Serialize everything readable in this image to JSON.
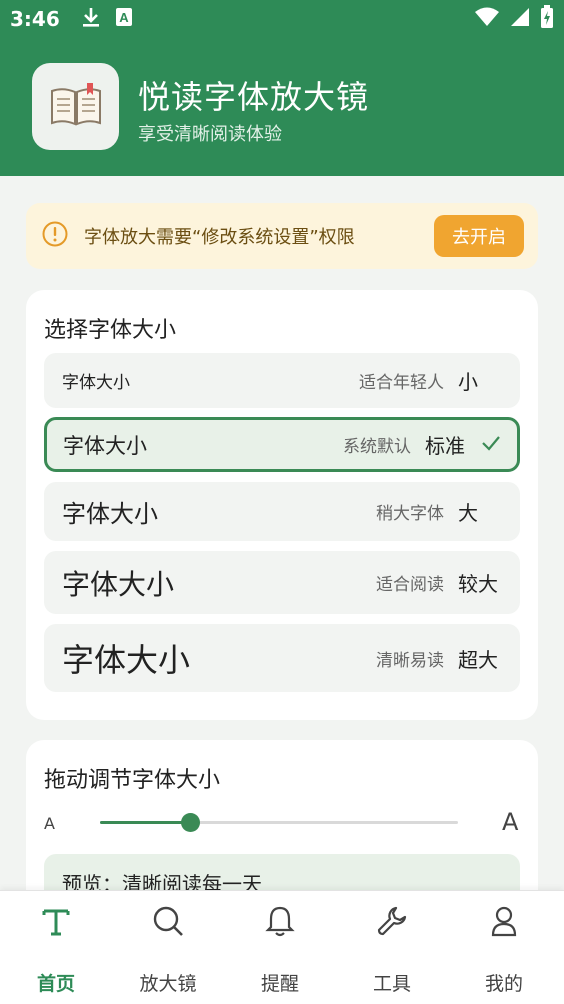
{
  "status_bar": {
    "time": "3:46",
    "icons_left": [
      "download-icon",
      "a-badge-icon"
    ],
    "icons_right": [
      "wifi-icon",
      "signal-icon",
      "battery-charging-icon"
    ]
  },
  "header": {
    "title": "悦读字体放大镜",
    "subtitle": "享受清晰阅读体验",
    "logo_icon": "open-book-icon",
    "background_color": "#2e8b57"
  },
  "permission_banner": {
    "icon": "info-icon",
    "text": "字体放大需要“修改系统设置”权限",
    "button_label": "去开启",
    "background_color": "#fdf4dc",
    "button_color": "#f0a530"
  },
  "font_size_card": {
    "title": "选择字体大小",
    "options": [
      {
        "sample": "字体大小",
        "desc": "适合年轻人",
        "size": "小",
        "selected": false
      },
      {
        "sample": "字体大小",
        "desc": "系统默认",
        "size": "标准",
        "selected": true
      },
      {
        "sample": "字体大小",
        "desc": "稍大字体",
        "size": "大",
        "selected": false
      },
      {
        "sample": "字体大小",
        "desc": "适合阅读",
        "size": "较大",
        "selected": false
      },
      {
        "sample": "字体大小",
        "desc": "清晰易读",
        "size": "超大",
        "selected": false
      }
    ]
  },
  "slider_card": {
    "title": "拖动调节字体大小",
    "min_label": "A",
    "max_label": "A",
    "value_fraction": 0.25,
    "preview_text": "预览：清晰阅读每一天"
  },
  "bottom_nav": {
    "active_index": 0,
    "accent_color": "#2e8b57",
    "items": [
      {
        "label": "首页",
        "icon": "text-t-icon"
      },
      {
        "label": "放大镜",
        "icon": "magnifier-icon"
      },
      {
        "label": "提醒",
        "icon": "bell-icon"
      },
      {
        "label": "工具",
        "icon": "wrench-icon"
      },
      {
        "label": "我的",
        "icon": "person-icon"
      }
    ]
  }
}
